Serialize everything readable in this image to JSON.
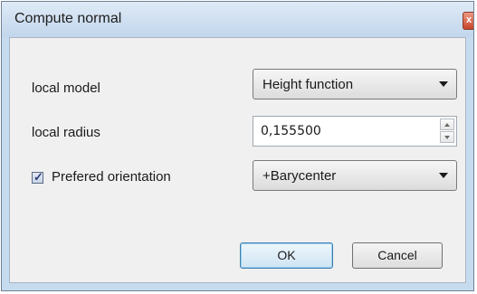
{
  "dialog": {
    "title": "Compute normal",
    "close_glyph": "x"
  },
  "fields": {
    "local_model_label": "local model",
    "local_model_value": "Height function",
    "local_radius_label": "local radius",
    "local_radius_value": "0,155500",
    "orientation_label": "Prefered orientation",
    "orientation_checked": true,
    "orientation_value": "+Barycenter"
  },
  "buttons": {
    "ok": "OK",
    "cancel": "Cancel"
  }
}
